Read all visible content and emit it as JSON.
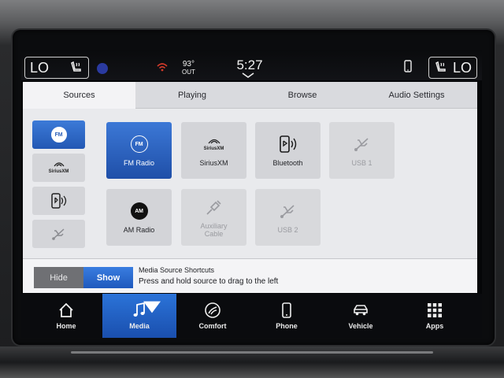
{
  "status_bar": {
    "climate_left": "LO",
    "climate_right": "LO",
    "outside_temp": "93°",
    "outside_label": "OUT",
    "clock": "5:27"
  },
  "tabs": [
    {
      "label": "Sources",
      "active": true
    },
    {
      "label": "Playing",
      "active": false
    },
    {
      "label": "Browse",
      "active": false
    },
    {
      "label": "Audio Settings",
      "active": false
    }
  ],
  "shortcuts": [
    {
      "icon": "fm-icon",
      "badge": "FM",
      "active": true
    },
    {
      "icon": "siriusxm-icon",
      "badge": "SiriusXM",
      "active": false
    },
    {
      "icon": "bluetooth-phone-icon",
      "active": false
    },
    {
      "icon": "usb-icon",
      "active": false
    }
  ],
  "sources": [
    {
      "label": "FM Radio",
      "icon": "fm-icon",
      "badge": "FM",
      "state": "active"
    },
    {
      "label": "SiriusXM",
      "icon": "siriusxm-icon",
      "badge": "SiriusXM",
      "state": "normal"
    },
    {
      "label": "Bluetooth",
      "icon": "bluetooth-phone-icon",
      "state": "normal"
    },
    {
      "label": "USB 1",
      "icon": "usb-icon",
      "state": "disabled"
    },
    {
      "label": "AM Radio",
      "icon": "am-icon",
      "badge": "AM",
      "state": "normal"
    },
    {
      "label": "Auxiliary Cable",
      "label_line1": "Auxiliary",
      "label_line2": "Cable",
      "icon": "aux-cable-icon",
      "state": "disabled"
    },
    {
      "label": "USB 2",
      "icon": "usb-icon",
      "state": "disabled"
    }
  ],
  "footer": {
    "hide_label": "Hide",
    "show_label": "Show",
    "hint_title": "Media Source Shortcuts",
    "hint_text": "Press and hold source to drag to the left"
  },
  "nav": [
    {
      "label": "Home",
      "icon": "home-icon",
      "active": false
    },
    {
      "label": "Media",
      "icon": "music-note-icon",
      "active": true
    },
    {
      "label": "Comfort",
      "icon": "steering-wheel-icon",
      "active": false
    },
    {
      "label": "Phone",
      "icon": "phone-icon",
      "active": false
    },
    {
      "label": "Vehicle",
      "icon": "car-icon",
      "active": false
    },
    {
      "label": "Apps",
      "icon": "apps-grid-icon",
      "active": false
    }
  ],
  "colors": {
    "accent_blue": "#2a63c4",
    "panel_bg": "#e9eaed",
    "tile_bg": "#d3d4d8",
    "nav_bg": "#0a0b0e"
  }
}
